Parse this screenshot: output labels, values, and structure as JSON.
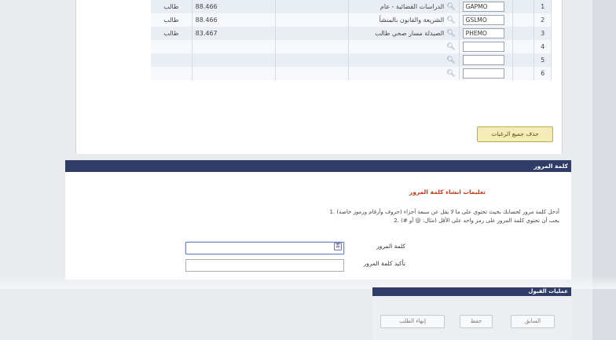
{
  "choices": [
    {
      "num": "1",
      "code": "GAPMO",
      "name": "الدراسات القضائية - عام",
      "rate": "88.466",
      "gender": "طالب"
    },
    {
      "num": "2",
      "code": "GSLMO",
      "name": "الشريعة والقانون بالمنشأ",
      "rate": "88.466",
      "gender": "طالب"
    },
    {
      "num": "3",
      "code": "PHEMO",
      "name": "الصيدلة مسار صحي طالب",
      "rate": "83.467",
      "gender": "طالب"
    },
    {
      "num": "4",
      "code": "",
      "name": "",
      "rate": "",
      "gender": ""
    },
    {
      "num": "5",
      "code": "",
      "name": "",
      "rate": "",
      "gender": ""
    },
    {
      "num": "6",
      "code": "",
      "name": "",
      "rate": "",
      "gender": ""
    }
  ],
  "delete_all_label": "حذف جميع الرغبات",
  "password_section": {
    "title": "كلمة المرور",
    "instructions_title": "تعليمات انشاء كلمة المرور",
    "instruction_1": "1. أدخل كلمة مرور لحسابك بحيث تحتوي على ما لا يقل عن سبعة أجزاء (حروف وأرقام ورموز خاصة)",
    "instruction_2": "2. يجب أن تحتوي كلمة المرور على رمز واحد على الأقل (مثال: @ أو #)",
    "password_label": "كلمة المرور",
    "confirm_label": "تأكيد كلمة المرور",
    "password_value": "",
    "confirm_value": ""
  },
  "nav_section": {
    "title": "عمليات القبول",
    "previous_label": "السابق",
    "save_label": "حفظ",
    "end_request_label": "إنهاء الطلب"
  },
  "colors": {
    "section_header": "#2f3c67",
    "instructions_title": "#c33a1a",
    "delete_button": "#f4ecb6"
  }
}
